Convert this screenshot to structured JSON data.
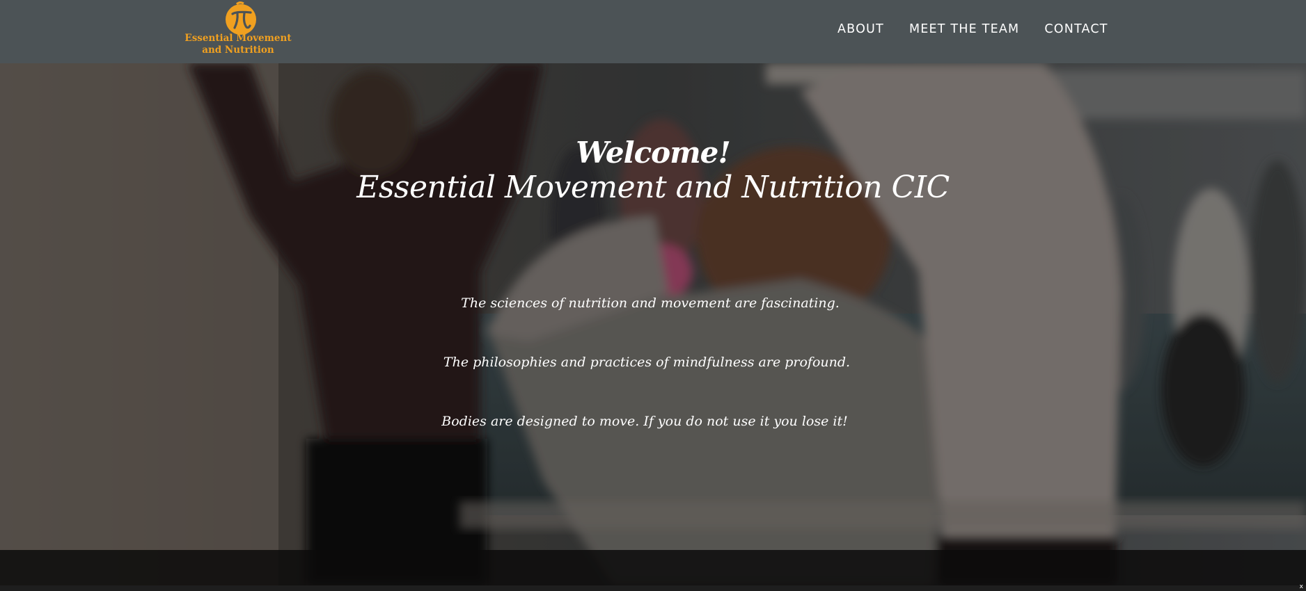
{
  "header": {
    "logo_text": "Essential Movement and Nutrition",
    "logo_color": "#f0a020",
    "background": "#4c5356",
    "nav": [
      {
        "label": "ABOUT"
      },
      {
        "label": "MEET THE TEAM"
      },
      {
        "label": "CONTACT"
      }
    ]
  },
  "hero": {
    "welcome": "Welcome!",
    "subtitle": "Essential Movement and Nutrition CIC",
    "lines": [
      "The sciences of nutrition and movement are fascinating.",
      "The philosophies and practices of mindfulness are profound.",
      "Bodies are designed to move. If you do not use it you lose it!"
    ],
    "background_image": "group-exercise-class-photo"
  },
  "footer": {
    "close_label": "x"
  }
}
